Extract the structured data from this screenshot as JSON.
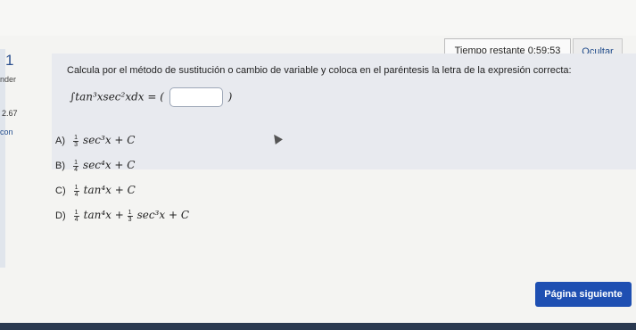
{
  "header": {
    "timer_label": "Tiempo restante",
    "timer_value": "0:59:53",
    "hide_label": "Ocultar"
  },
  "sidebar": {
    "question_number": "1",
    "label": "nder",
    "score": "2.67",
    "link": "con"
  },
  "question": {
    "prompt": "Calcula por el método de sustitución o cambio de variable y coloca en el paréntesis la letra de la expresión correcta:",
    "integral": "∫tan³xsec²xdx = (",
    "closing_paren": ")",
    "answer_value": ""
  },
  "options": [
    {
      "letter": "A)",
      "num": "1",
      "den": "3",
      "expr": "sec³x + C"
    },
    {
      "letter": "B)",
      "num": "1",
      "den": "4",
      "expr": "sec⁴x + C"
    },
    {
      "letter": "C)",
      "num": "1",
      "den": "4",
      "expr": "tan⁴x + C"
    },
    {
      "letter": "D)",
      "num": "1",
      "den": "4",
      "expr": "tan⁴x + ",
      "num2": "1",
      "den2": "3",
      "expr2": "sec³x + C"
    }
  ],
  "footer": {
    "next_label": "Página siguiente"
  },
  "colors": {
    "accent": "#1e4fb2",
    "bottom_bar": "#2a3950",
    "content_bg": "#e8eaef"
  }
}
